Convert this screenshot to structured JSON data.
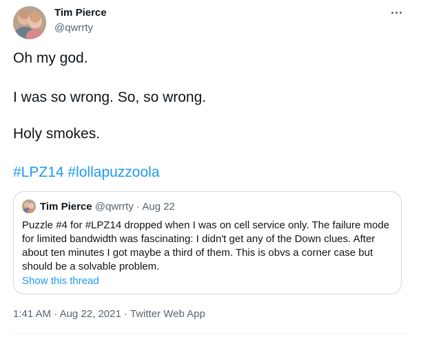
{
  "author": {
    "name": "Tim Pierce",
    "handle": "@qwrrty"
  },
  "tweet": {
    "lines": [
      "Oh my god.",
      "I was so wrong. So, so wrong.",
      "Holy smokes."
    ],
    "hashtags": [
      "#LPZ14",
      "#lollapuzzoola"
    ]
  },
  "quote": {
    "name": "Tim Pierce",
    "handle": "@qwrrty",
    "separator": "·",
    "date": "Aug 22",
    "text": "Puzzle #4 for #LPZ14 dropped when I was on cell service only. The failure mode for limited bandwidth was fascinating: I didn't get any of the Down clues. After about ten minutes I got maybe a third of them. This is obvs a corner case but should be a solvable problem.",
    "show_thread": "Show this thread"
  },
  "meta": {
    "time": "1:41 AM",
    "separator": "·",
    "date": "Aug 22, 2021",
    "source": "Twitter Web App"
  },
  "icons": {
    "more": "more-horizontal-icon"
  },
  "colors": {
    "link": "#1d9bf0",
    "secondary_text": "#536471",
    "primary_text": "#0f1419",
    "border": "#cfd9de"
  }
}
